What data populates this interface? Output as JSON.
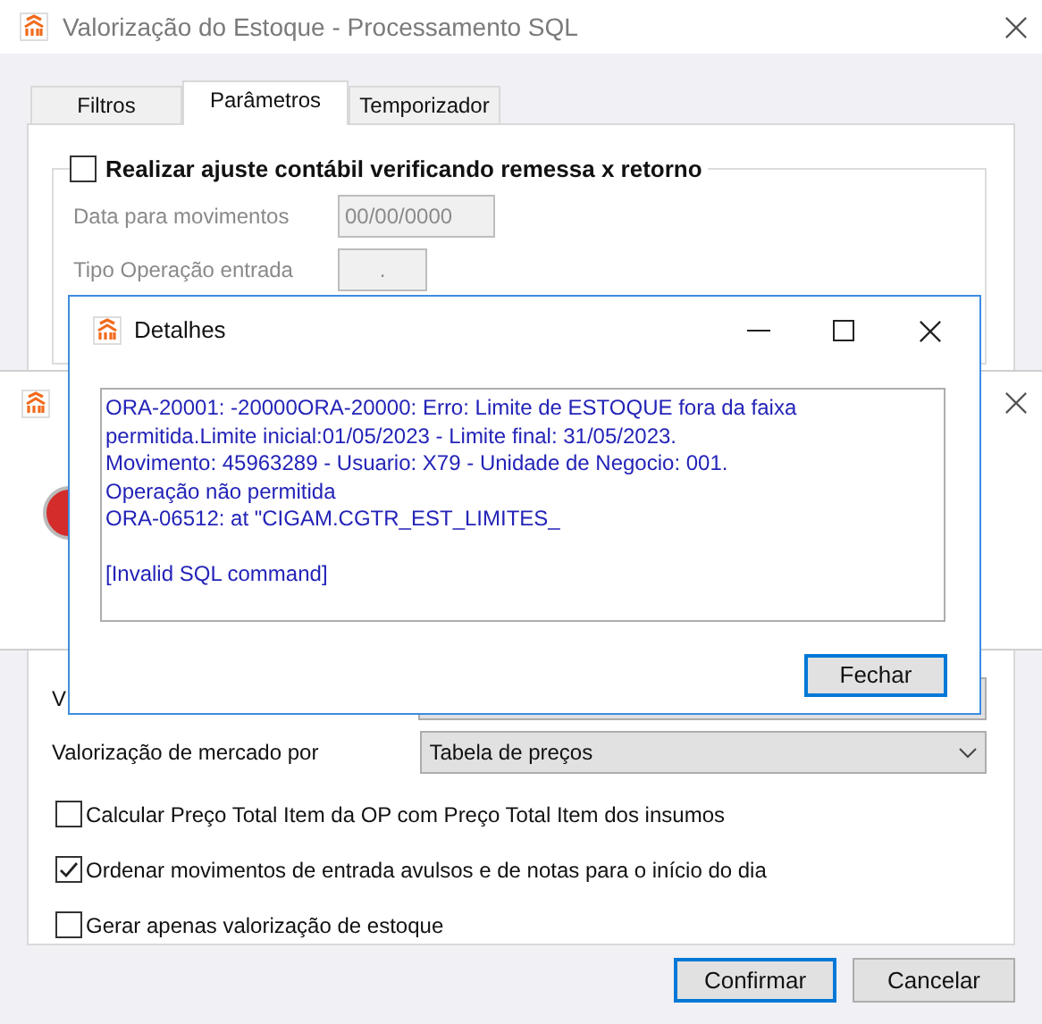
{
  "window": {
    "title": "Valorização do Estoque - Processamento SQL"
  },
  "tabs": [
    {
      "label": "Filtros",
      "selected": false
    },
    {
      "label": "Parâmetros",
      "selected": true
    },
    {
      "label": "Temporizador",
      "selected": false
    }
  ],
  "group": {
    "label": "Realizar ajuste contábil verificando remessa x retorno",
    "checked": false,
    "fields": [
      {
        "label": "Data para movimentos",
        "value": "00/00/0000",
        "kind": "wide",
        "disabled": true
      },
      {
        "label": "Tipo Operação entrada",
        "value": ".",
        "kind": "narrow",
        "disabled": true
      }
    ]
  },
  "covered_label": "V",
  "market_valuation": {
    "label": "Valorização de mercado por",
    "value": "Tabela de preços"
  },
  "options": [
    {
      "label": "Calcular Preço Total Item da OP com Preço Total Item dos insumos",
      "checked": false
    },
    {
      "label": "Ordenar movimentos de entrada avulsos e de notas para o início do dia",
      "checked": true
    },
    {
      "label": "Gerar apenas valorização de estoque",
      "checked": false
    }
  ],
  "buttons": [
    {
      "label": "Confirmar",
      "default": true
    },
    {
      "label": "Cancelar",
      "default": false
    }
  ],
  "details_dialog": {
    "title": "Detalhes",
    "message": "ORA-20001: -20000ORA-20000: Erro: Limite de ESTOQUE fora da faixa\npermitida.Limite inicial:01/05/2023 - Limite final: 31/05/2023.\nMovimento: 45963289 - Usuario: X79 - Unidade de Negocio: 001.\nOperação não permitida\nORA-06512: at \"CIGAM.CGTR_EST_LIMITES_\n\n[Invalid SQL command]",
    "button": {
      "label": "Fechar",
      "default": true
    }
  }
}
